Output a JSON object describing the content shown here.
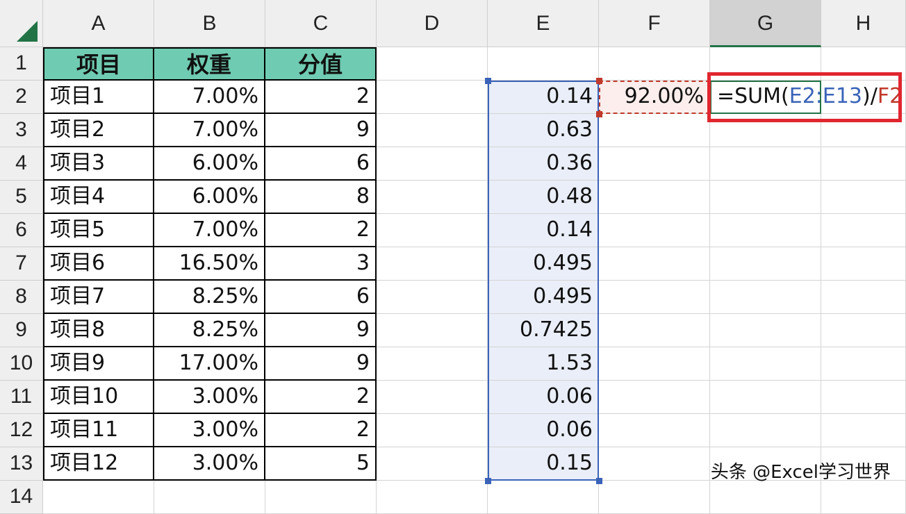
{
  "columns": [
    "A",
    "B",
    "C",
    "D",
    "E",
    "F",
    "G",
    "H"
  ],
  "rows": [
    "1",
    "2",
    "3",
    "4",
    "5",
    "6",
    "7",
    "8",
    "9",
    "10",
    "11",
    "12",
    "13",
    "14"
  ],
  "table": {
    "headers": [
      "项目",
      "权重",
      "分值"
    ],
    "rows": [
      [
        "项目1",
        "7.00%",
        "2"
      ],
      [
        "项目2",
        "7.00%",
        "9"
      ],
      [
        "项目3",
        "6.00%",
        "6"
      ],
      [
        "项目4",
        "6.00%",
        "8"
      ],
      [
        "项目5",
        "7.00%",
        "2"
      ],
      [
        "项目6",
        "16.50%",
        "3"
      ],
      [
        "项目7",
        "8.25%",
        "6"
      ],
      [
        "项目8",
        "8.25%",
        "9"
      ],
      [
        "项目9",
        "17.00%",
        "9"
      ],
      [
        "项目10",
        "3.00%",
        "2"
      ],
      [
        "项目11",
        "3.00%",
        "2"
      ],
      [
        "项目12",
        "3.00%",
        "5"
      ]
    ]
  },
  "col_e": [
    "0.14",
    "0.63",
    "0.36",
    "0.48",
    "0.14",
    "0.495",
    "0.495",
    "0.7425",
    "1.53",
    "0.06",
    "0.06",
    "0.15"
  ],
  "f2": "92.00%",
  "formula": {
    "prefix": "=SUM(",
    "range": "E2:E13",
    "mid": ")/",
    "ref": "F2"
  },
  "watermark": "头条 @Excel学习世界",
  "colors": {
    "header_fill": "#6fcbb1",
    "range_blue": "#3a63b8",
    "ref_red": "#c0392b",
    "highlight_box": "#e0262f",
    "selected_col_bar": "#217346"
  }
}
